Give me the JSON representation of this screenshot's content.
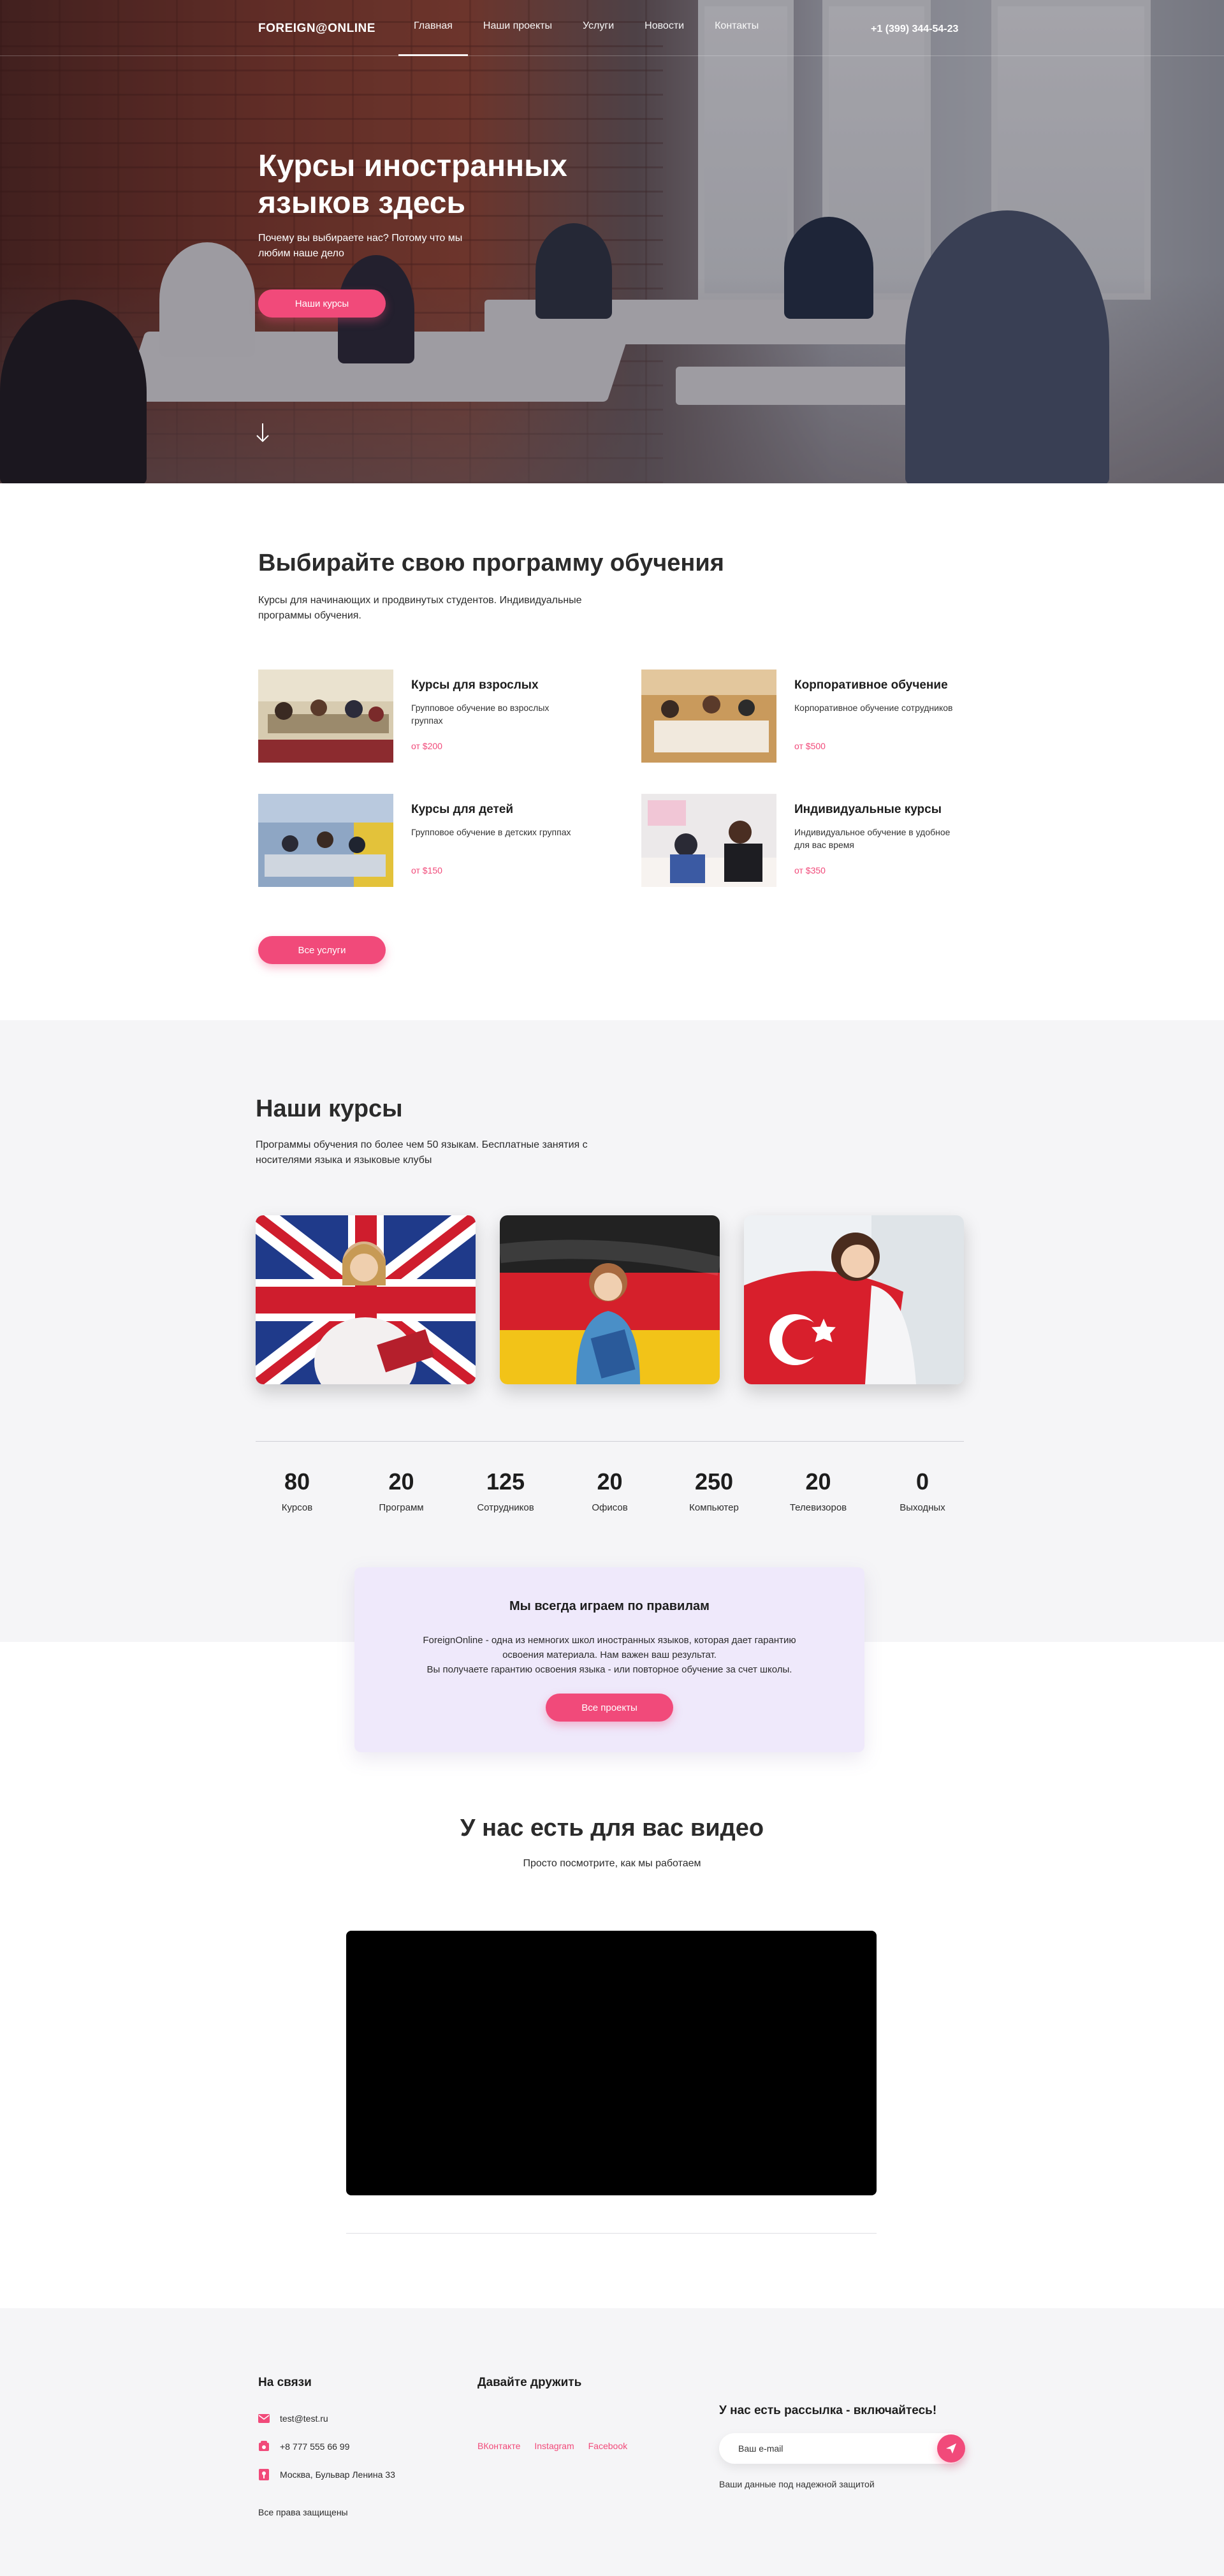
{
  "colors": {
    "accent": "#f14a7a",
    "light_bg": "#f5f5f7",
    "rules_bg": "#efe9fb",
    "text": "#2b2b2b"
  },
  "header": {
    "logo": "FOREIGN@ONLINE",
    "nav": [
      {
        "label": "Главная",
        "active": true
      },
      {
        "label": "Наши проекты"
      },
      {
        "label": "Услуги"
      },
      {
        "label": "Новости"
      },
      {
        "label": "Контакты"
      }
    ],
    "phone": "+1 (399) 344-54-23"
  },
  "hero": {
    "title": "Курсы иностранных языков здесь",
    "subtitle": "Почему вы выбираете нас? Потому что мы любим наше дело",
    "button": "Наши курсы",
    "scroll_icon": "arrow-down-icon"
  },
  "programs": {
    "title": "Выбирайте свою программу обучения",
    "subtitle": "Курсы для начинающих и продвинутых студентов. Индивидуальные программы обучения.",
    "items": [
      {
        "title": "Курсы для взрослых",
        "desc": "Групповое обучение во взрослых группах",
        "price": "от $200"
      },
      {
        "title": "Корпоративное обучение",
        "desc": "Корпоративное обучение сотрудников",
        "price": "от $500"
      },
      {
        "title": "Курсы для детей",
        "desc": "Групповое обучение в детских группах",
        "price": "от $150"
      },
      {
        "title": "Индивидуальные курсы",
        "desc": "Индивидуальное обучение в удобное для вас время",
        "price": "от $350"
      }
    ],
    "button": "Все услуги"
  },
  "courses": {
    "title": "Наши курсы",
    "subtitle": "Программы обучения по более чем 50 языкам. Бесплатные занятия с носителями языка и языковые клубы",
    "cards": [
      "uk-flag",
      "germany-flag",
      "turkey-flag"
    ]
  },
  "stats": [
    {
      "value": "80",
      "label": "Курсов"
    },
    {
      "value": "20",
      "label": "Программ"
    },
    {
      "value": "125",
      "label": "Сотрудников"
    },
    {
      "value": "20",
      "label": "Офисов"
    },
    {
      "value": "250",
      "label": "Компьютер"
    },
    {
      "value": "20",
      "label": "Телевизоров"
    },
    {
      "value": "0",
      "label": "Выходных"
    }
  ],
  "rules": {
    "title": "Мы всегда играем по правилам",
    "text1": "ForeignOnline - одна из немногих школ иностранных языков, которая дает гарантию освоения материала. Нам важен ваш результат.",
    "text2": "Вы получаете гарантию освоения языка - или повторное обучение за счет школы.",
    "button": "Все проекты"
  },
  "video": {
    "title": "У нас есть для вас видео",
    "subtitle": "Просто посмотрите, как мы работаем"
  },
  "footer": {
    "contact_title": "На связи",
    "email": "test@test.ru",
    "phone": "+8 777 555 66 99",
    "address": "Москва, Бульвар Ленина 33",
    "rights": "Все права защищены",
    "friends_title": "Давайте дружить",
    "socials": [
      "ВКонтакте",
      "Instagram",
      "Facebook"
    ],
    "news_title": "У нас есть рассылка - включайтесь!",
    "email_placeholder": "Ваш e-mail",
    "secure_note": "Ваши данные под надежной защитой"
  }
}
